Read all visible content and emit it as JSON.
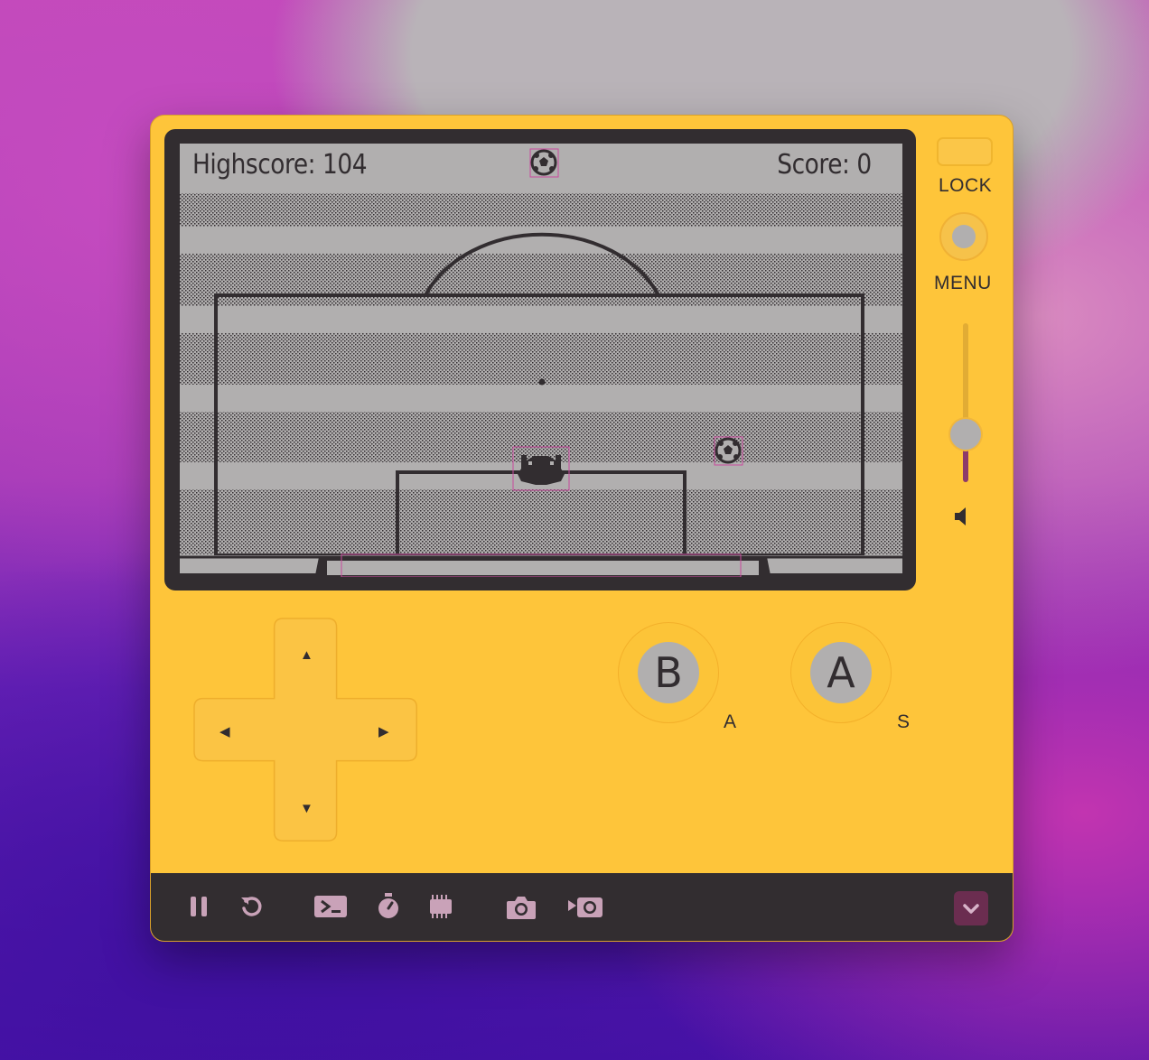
{
  "screen": {
    "highscore_text": "Highscore: 104",
    "score_text": "Score: 0"
  },
  "side_controls": {
    "lock_label": "LOCK",
    "menu_label": "MENU",
    "volume_level": 0.3
  },
  "face_buttons": {
    "b_label": "B",
    "a_label": "A",
    "b_key_hint": "A",
    "a_key_hint": "S"
  },
  "dpad": {
    "up": "▲",
    "down": "▼",
    "left": "◀",
    "right": "▶"
  },
  "toolbar": {
    "icons": [
      "pause-icon",
      "restart-icon",
      "console-icon",
      "stopwatch-icon",
      "cpu-icon",
      "screenshot-icon",
      "record-video-icon",
      "collapse-chevron-icon"
    ]
  },
  "colors": {
    "device_body": "#fec53a",
    "screen_bezel": "#322d30",
    "lcd_background": "#b1afaf",
    "lcd_ink": "#322d30",
    "debug_outline": "#c94a9e",
    "toolbar_icon": "#c9a2b8"
  }
}
